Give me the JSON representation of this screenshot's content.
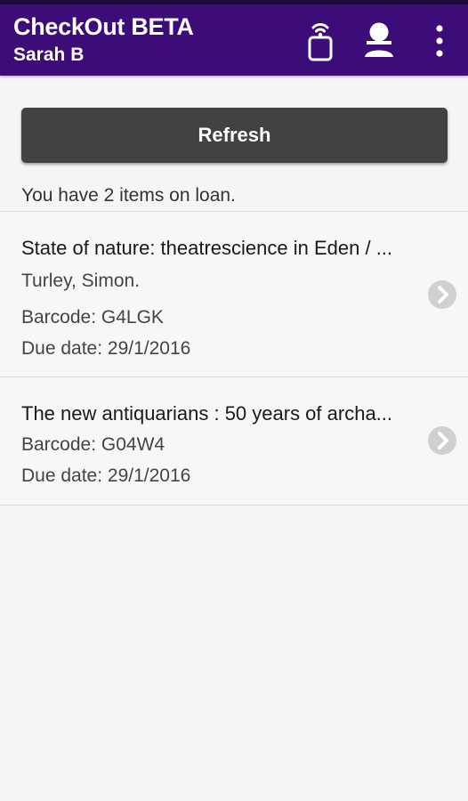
{
  "app_bar": {
    "title": "CheckOut BETA",
    "subtitle": "Sarah B",
    "background_color": "#3c0d78",
    "actions": [
      {
        "icon": "nfc-phone-icon"
      },
      {
        "icon": "account-icon"
      },
      {
        "icon": "more-vertical-icon"
      }
    ]
  },
  "refresh_label": "Refresh",
  "loan_summary": "You have 2 items on loan.",
  "loans": [
    {
      "title": "State of nature: theatrescience in Eden / ...",
      "author": "Turley, Simon.",
      "barcode": "Barcode: G4LGK",
      "due_date": "Due date: 29/1/2016"
    },
    {
      "title": "The new antiquarians : 50 years of archa...",
      "barcode": "Barcode: G04W4",
      "due_date": "Due date: 29/1/2016"
    }
  ],
  "colors": {
    "status_bar": "#1e0b3c",
    "button": "#424242",
    "chevron": "#d0d0d0"
  }
}
